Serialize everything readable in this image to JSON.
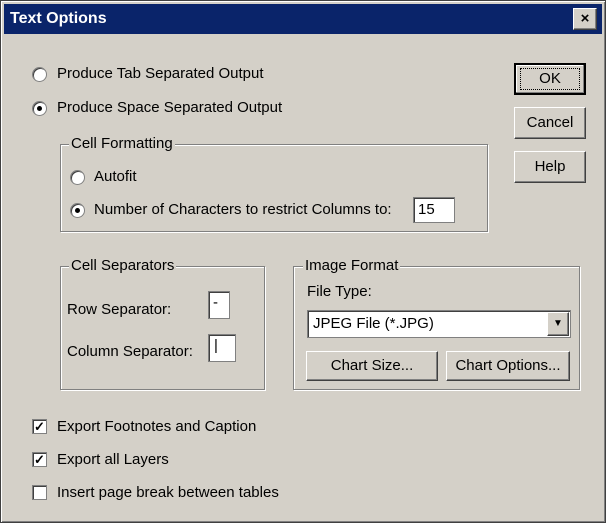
{
  "window": {
    "title": "Text Options",
    "close_glyph": "×"
  },
  "output": {
    "tab_label": "Produce Tab Separated Output",
    "space_label": "Produce Space Separated Output",
    "selected": "space"
  },
  "cell_formatting": {
    "title": "Cell Formatting",
    "autofit_label": "Autofit",
    "num_chars_label": "Number of Characters to restrict Columns to:",
    "num_chars_value": "15",
    "selected": "num_chars"
  },
  "cell_separators": {
    "title": "Cell Separators",
    "row_label": "Row Separator:",
    "row_value": "-",
    "column_label": "Column Separator:",
    "column_value": "|"
  },
  "image_format": {
    "title": "Image Format",
    "file_type_label": "File Type:",
    "file_type_value": "JPEG File (*.JPG)",
    "chart_size_label": "Chart Size...",
    "chart_options_label": "Chart Options..."
  },
  "buttons": {
    "ok": "OK",
    "cancel": "Cancel",
    "help": "Help"
  },
  "options": {
    "footnotes_label": "Export Footnotes and Caption",
    "footnotes_checked": true,
    "layers_label": "Export all Layers",
    "layers_checked": true,
    "pagebreak_label": "Insert page break between tables",
    "pagebreak_checked": false
  },
  "icons": {
    "check": "check-icon",
    "dropdown": "chevron-down-icon"
  }
}
